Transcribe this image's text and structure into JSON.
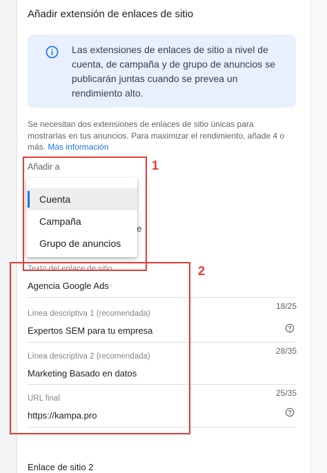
{
  "panel": {
    "title": "Añadir extensión de enlaces de sitio",
    "info_text": "Las extensiones de enlaces de sitio a nivel de cuenta, de campaña y de grupo de anuncios se publicarán juntas cuando se prevea un rendimiento alto.",
    "description": "Se necesitan dos extensiones de enlaces de sitio únicas para mostrarlas en tus anuncios. Para maximizar el rendimiento, añade 4 o más.",
    "more_info_link": "Más información",
    "add_to_label": "Añadir a",
    "partial_text_behind_dropdown": "ente"
  },
  "dropdown": {
    "options": [
      {
        "label": "Cuenta",
        "selected": true
      },
      {
        "label": "Campaña",
        "selected": false
      },
      {
        "label": "Grupo de anuncios",
        "selected": false
      }
    ]
  },
  "fields": {
    "link_text": {
      "label": "Texto del enlace de sitio",
      "value": "Agencia Google Ads"
    },
    "desc1": {
      "label": "Línea descriptiva 1 (recomendada)",
      "value": "Expertos SEM para tu empresa",
      "counter": "18/25"
    },
    "desc2": {
      "label": "Línea descriptiva 2 (recomendada)",
      "value": "Marketing Basado en datos",
      "counter": "28/35"
    },
    "final_url": {
      "label": "URL final",
      "value": "https://kampa.pro",
      "counter": "25/35"
    }
  },
  "section2_title": "Enlace de sitio 2",
  "annotations": {
    "one": "1",
    "two": "2",
    "color": "#e53935"
  },
  "colors": {
    "accent": "#1a73e8",
    "info_background": "#e8f0fe"
  }
}
